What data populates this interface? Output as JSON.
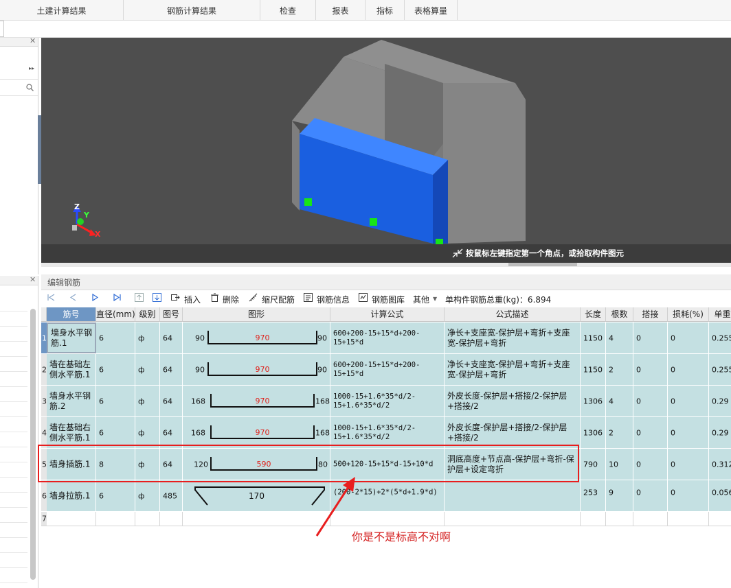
{
  "menu": {
    "tabs": [
      "土建计算结果",
      "钢筋计算结果",
      "检查",
      "报表",
      "指标",
      "表格算量"
    ]
  },
  "viewport": {
    "hint": "按鼠标左键指定第一个角点，或拾取构件图元",
    "axes": {
      "z": "Z",
      "y": "Y",
      "x": "X"
    }
  },
  "panel": {
    "title": "编辑钢筋",
    "toolbar": {
      "insert": "插入",
      "delete": "删除",
      "scale_config": "缩尺配筋",
      "rebar_info": "钢筋信息",
      "rebar_library": "钢筋图库",
      "other": "其他",
      "total_label": "单构件钢筋总重(kg)：6.894"
    },
    "columns": [
      "筋号",
      "直径(mm)",
      "级别",
      "图号",
      "图形",
      "计算公式",
      "公式描述",
      "长度",
      "根数",
      "搭接",
      "损耗(%)",
      "单重"
    ],
    "rows": [
      {
        "num": "1",
        "name": "墙身水平钢筋.1",
        "dia": "6",
        "grade": "ф",
        "fig": "64",
        "left": "90",
        "mid": "970",
        "right": "90",
        "formula": "600+200-15+15*d+200-15+15*d",
        "desc": "净长+支座宽-保护层+弯折+支座宽-保护层+弯折",
        "length": "1150",
        "count": "4",
        "lap": "0",
        "loss": "0",
        "weight": "0.255"
      },
      {
        "num": "2",
        "name": "墙在基础左侧水平筋.1",
        "dia": "6",
        "grade": "ф",
        "fig": "64",
        "left": "90",
        "mid": "970",
        "right": "90",
        "formula": "600+200-15+15*d+200-15+15*d",
        "desc": "净长+支座宽-保护层+弯折+支座宽-保护层+弯折",
        "length": "1150",
        "count": "2",
        "lap": "0",
        "loss": "0",
        "weight": "0.255"
      },
      {
        "num": "3",
        "name": "墙身水平钢筋.2",
        "dia": "6",
        "grade": "ф",
        "fig": "64",
        "left": "168",
        "mid": "970",
        "right": "168",
        "formula": "1000-15+1.6*35*d/2-15+1.6*35*d/2",
        "desc": "外皮长度-保护层+搭接/2-保护层+搭接/2",
        "length": "1306",
        "count": "4",
        "lap": "0",
        "loss": "0",
        "weight": "0.29"
      },
      {
        "num": "4",
        "name": "墙在基础右侧水平筋.1",
        "dia": "6",
        "grade": "ф",
        "fig": "64",
        "left": "168",
        "mid": "970",
        "right": "168",
        "formula": "1000-15+1.6*35*d/2-15+1.6*35*d/2",
        "desc": "外皮长度-保护层+搭接/2-保护层+搭接/2",
        "length": "1306",
        "count": "2",
        "lap": "0",
        "loss": "0",
        "weight": "0.29"
      },
      {
        "num": "5",
        "name": "墙身插筋.1",
        "dia": "8",
        "grade": "ф",
        "fig": "64",
        "left": "120",
        "mid": "590",
        "right": "80",
        "formula": "500+120-15+15*d-15+10*d",
        "desc": "洞底高度+节点高-保护层+弯折-保护层+设定弯折",
        "length": "790",
        "count": "10",
        "lap": "0",
        "loss": "0",
        "weight": "0.312"
      },
      {
        "num": "6",
        "name": "墙身拉筋.1",
        "dia": "6",
        "grade": "ф",
        "fig": "485",
        "left": "",
        "mid": "170",
        "right": "",
        "formula": "(200-2*15)+2*(5*d+1.9*d)",
        "desc": "",
        "length": "253",
        "count": "9",
        "lap": "0",
        "loss": "0",
        "weight": "0.056"
      },
      {
        "num": "7",
        "name": "",
        "dia": "",
        "grade": "",
        "fig": "",
        "left": "",
        "mid": "",
        "right": "",
        "formula": "",
        "desc": "",
        "length": "",
        "count": "",
        "lap": "",
        "loss": "",
        "weight": ""
      }
    ]
  },
  "annotation": {
    "text": "你是不是标高不对啊",
    "color": "#e81e1e"
  },
  "colors": {
    "row_bg": "#c4e0e2",
    "selected_header": "#6e96c4",
    "member_blue": "#1a5fe0",
    "grip_green": "#18e418",
    "viewport_bg": "#4e4e4e"
  }
}
